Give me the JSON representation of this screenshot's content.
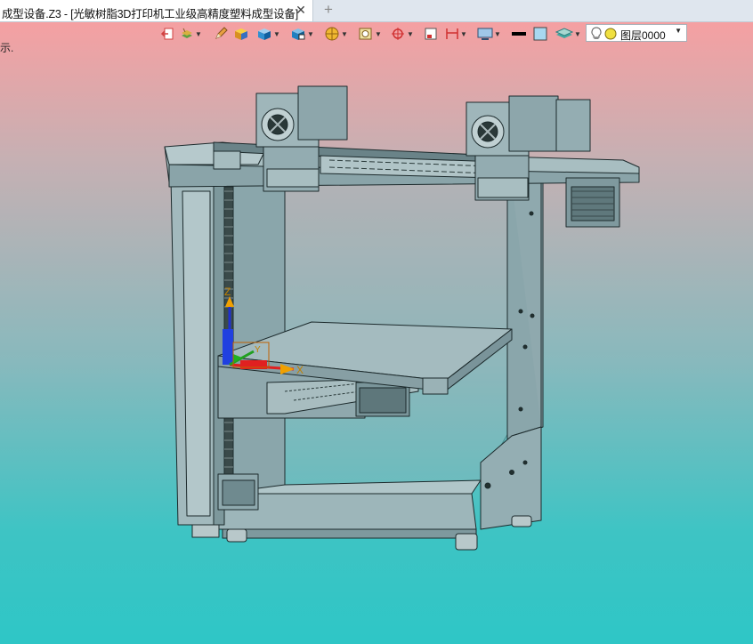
{
  "window": {
    "tab_title": "成型设备.Z3 - [光敏树脂3D打印机工业级高精度塑料成型设备]",
    "close_glyph": "✕",
    "add_glyph": "+"
  },
  "viewport": {
    "hint_text": "示."
  },
  "toolbar": {
    "items": [
      {
        "icon": "exit-sketch-icon"
      },
      {
        "icon": "layers-icon"
      },
      {
        "icon": "pencil-icon"
      },
      {
        "icon": "box-shaded-icon"
      },
      {
        "icon": "cube-view-icon"
      },
      {
        "icon": "view-orient-icon"
      },
      {
        "icon": "render-mode-icon"
      },
      {
        "icon": "snap-icon"
      },
      {
        "icon": "target-icon"
      },
      {
        "icon": "frame-icon"
      },
      {
        "icon": "dimension-icon"
      },
      {
        "icon": "display-icon"
      },
      {
        "icon": "line-color-icon"
      },
      {
        "icon": "fill-color-icon"
      },
      {
        "icon": "layer-stack-icon"
      }
    ],
    "layer_dropdown": {
      "value": "图层0000",
      "icons": [
        "lightbulb-icon",
        "layer-dot-icon"
      ]
    }
  },
  "model": {
    "triad_labels": {
      "x": "X",
      "y": "Y",
      "z": "Z"
    },
    "colors": {
      "part": "#96b1b6",
      "part_dark": "#7f9ba0",
      "edge": "#1c2a2c",
      "bed": "#a5bcc0",
      "axis_x": "#e02020",
      "axis_y": "#20a020",
      "axis_z": "#2030d0",
      "triad_label": "#c08000"
    }
  }
}
